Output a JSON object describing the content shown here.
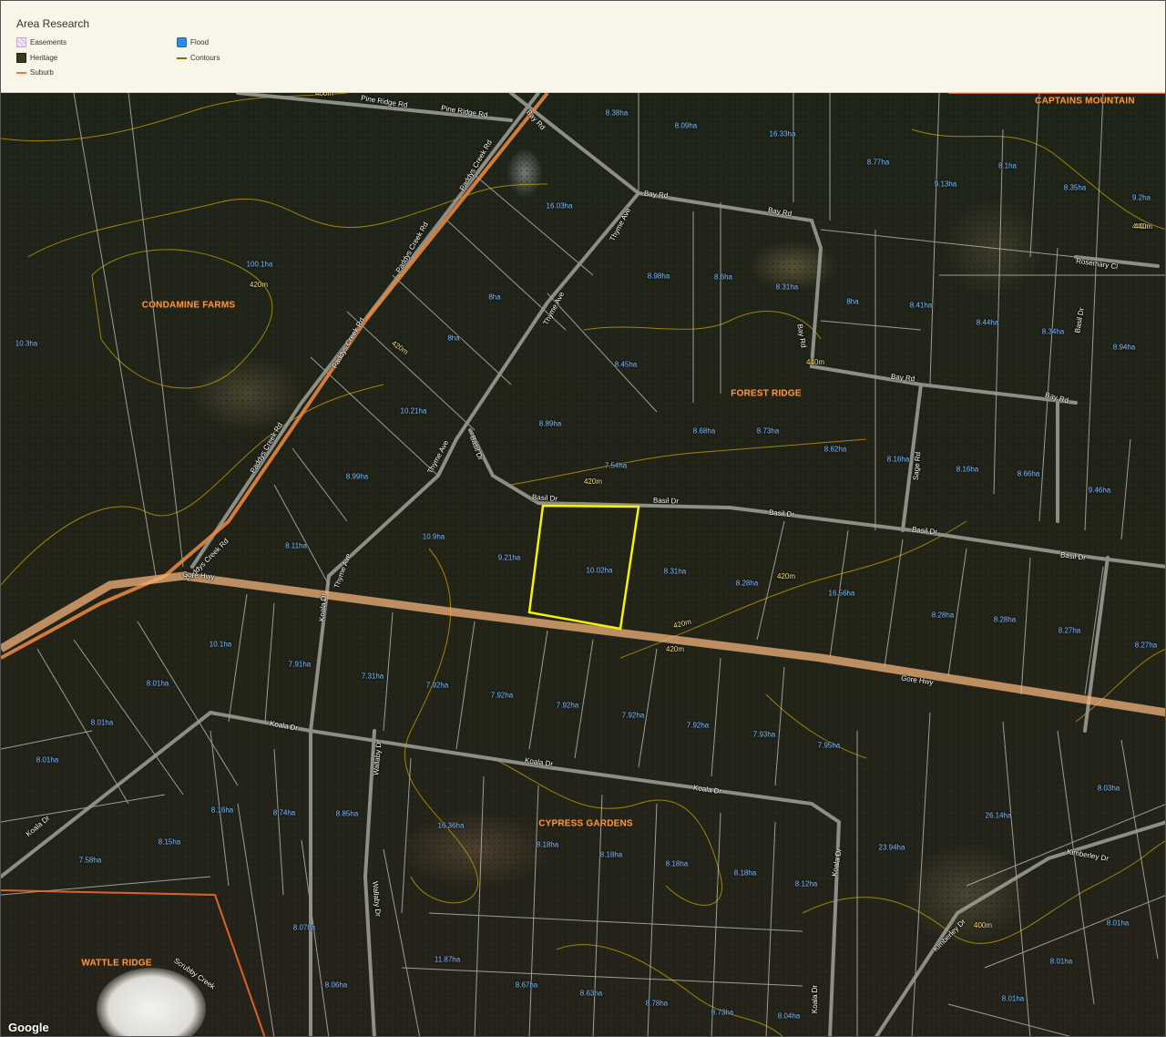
{
  "legend": {
    "title": "Area Research",
    "items": [
      {
        "label": "Easements",
        "kind": "easements"
      },
      {
        "label": "Flood",
        "kind": "flood"
      },
      {
        "label": "Heritage",
        "kind": "heritage"
      },
      {
        "label": "Contours",
        "kind": "contours"
      },
      {
        "label": "Suburb",
        "kind": "suburb"
      }
    ]
  },
  "colors": {
    "road": "#9a9a92",
    "highway": "#f0b37a",
    "parcel": "#cfcfcf",
    "contour": "#c8a400",
    "suburb_boundary": "#ef6a2a",
    "selected_parcel": "#f4f400",
    "area_label": "#7fb8ef",
    "suburb_label": "#f2994a"
  },
  "suburbs": [
    "CAPTAINS MOUNTAIN",
    "CONDAMINE FARMS",
    "FOREST RIDGE",
    "CYPRESS GARDENS",
    "WATTLE RIDGE"
  ],
  "roads": [
    "Pine Ridge Rd",
    "Pine Ridge Rd",
    "Bay Rd",
    "Bay Rd",
    "Bay Rd",
    "Bay Rd",
    "Bay Rd",
    "Bay Rd",
    "Paddys Creek Rd",
    "Paddys Creek Rd",
    "Paddys Creek Rd",
    "Paddys Creek Rd",
    "Paddys Creek Rd",
    "Thyme Ave",
    "Thyme Ave",
    "Thyme Ave",
    "Thyme Ave",
    "Basil Dr",
    "Basil Dr",
    "Basil Dr",
    "Basil Dr",
    "Basil Dr",
    "Basil Dr",
    "Gore Hwy",
    "Gore Hwy",
    "Koala Dr",
    "Koala Dr",
    "Koala Dr",
    "Koala Dr",
    "Koala Dr",
    "Koala Dr",
    "Koala Dr",
    "Wallaby Dr",
    "Wallaby Dr",
    "Sage Rd",
    "Rosemary Cl",
    "Kimberley Dr",
    "Kimberley Dr",
    "Scrubby Creek",
    "Basil Dr"
  ],
  "contours": [
    "400m",
    "420m",
    "440m",
    "420m",
    "420m",
    "440m",
    "420m",
    "420m",
    "420m",
    "440m",
    "400m"
  ],
  "areas": [
    "8.38ha",
    "8.09ha",
    "16.33ha",
    "8.77ha",
    "8.1ha",
    "9.13ha",
    "8.35ha",
    "9.2ha",
    "16.03ha",
    "100.1ha",
    "8.98ha",
    "8.6ha",
    "8.31ha",
    "8ha",
    "8.41ha",
    "8.44ha",
    "8.34ha",
    "8ha",
    "8ha",
    "8.94ha",
    "10.3ha",
    "8.45ha",
    "10.21ha",
    "8.89ha",
    "8.68ha",
    "8.73ha",
    "8.62ha",
    "8.16ha",
    "8.16ha",
    "8.66ha",
    "9.46ha",
    "7.54ha",
    "8.99ha",
    "10.9ha",
    "9.21ha",
    "10.02ha",
    "8.31ha",
    "8.28ha",
    "16.56ha",
    "8.11ha",
    "8.28ha",
    "8.28ha",
    "8.27ha",
    "8.27ha",
    "10.1ha",
    "8.01ha",
    "7.91ha",
    "7.31ha",
    "7.92ha",
    "7.92ha",
    "7.92ha",
    "7.92ha",
    "7.92ha",
    "7.93ha",
    "7.95ha",
    "8.01ha",
    "8.01ha",
    "8.16ha",
    "8.74ha",
    "8.85ha",
    "16.36ha",
    "8.18ha",
    "8.18ha",
    "8.18ha",
    "8.18ha",
    "8.12ha",
    "26.14ha",
    "8.03ha",
    "8.15ha",
    "7.58ha",
    "23.94ha",
    "8.07ha",
    "11.87ha",
    "8.06ha",
    "8.67ha",
    "8.63ha",
    "8.78ha",
    "8.73ha",
    "8.04ha",
    "8.01ha",
    "8.01ha",
    "8.01ha"
  ],
  "attribution": "Google"
}
